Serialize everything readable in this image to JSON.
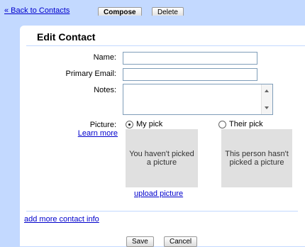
{
  "topbar": {
    "back_link": "« Back to Contacts",
    "compose_label": "Compose",
    "delete_label": "Delete"
  },
  "form": {
    "title": "Edit Contact",
    "name_label": "Name:",
    "name_value": "",
    "email_label": "Primary Email:",
    "email_value": "",
    "notes_label": "Notes:",
    "notes_value": "",
    "picture_label": "Picture:",
    "learn_more": "Learn more",
    "my_pick_label": "My pick",
    "their_pick_label": "Their pick",
    "my_pick_selected": true,
    "my_pick_placeholder": "You haven't picked a picture",
    "their_pick_placeholder": "This person hasn't picked a picture",
    "upload_link": "upload picture",
    "add_more_link": "add more contact info",
    "save_label": "Save",
    "cancel_label": "Cancel"
  },
  "colors": {
    "page_background": "#c3d9ff",
    "link": "#0000cc",
    "picture_box": "#e0e0e0"
  }
}
